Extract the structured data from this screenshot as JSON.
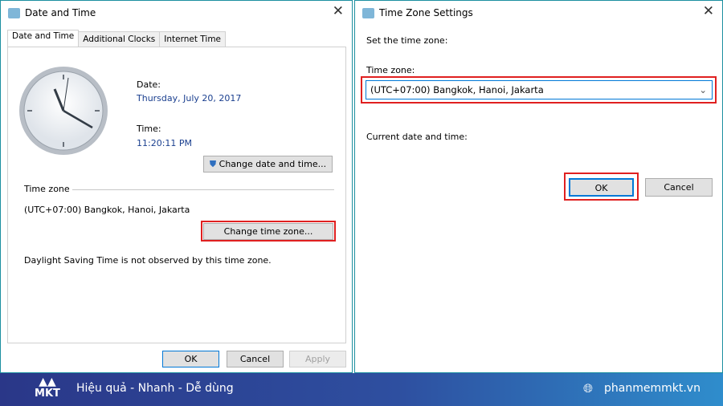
{
  "left_dialog": {
    "title": "Date and Time",
    "tabs": [
      "Date and Time",
      "Additional Clocks",
      "Internet Time"
    ],
    "date_label": "Date:",
    "date_value": "Thursday, July 20, 2017",
    "time_label": "Time:",
    "time_value": "11:20:11 PM",
    "change_date_button": "Change date and time...",
    "timezone_section": "Time zone",
    "timezone_value": "(UTC+07:00) Bangkok, Hanoi, Jakarta",
    "change_timezone_button": "Change time zone...",
    "dst_note": "Daylight Saving Time is not observed by this time zone.",
    "ok": "OK",
    "cancel": "Cancel",
    "apply": "Apply"
  },
  "right_dialog": {
    "title": "Time Zone Settings",
    "instruction": "Set the time zone:",
    "timezone_label": "Time zone:",
    "timezone_selected": "(UTC+07:00) Bangkok, Hanoi, Jakarta",
    "current_label": "Current date and time:",
    "ok": "OK",
    "cancel": "Cancel"
  },
  "banner": {
    "logo": "MKT",
    "slogan": "Hiệu quả - Nhanh - Dễ dùng",
    "website": "phanmemmkt.vn"
  },
  "colors": {
    "highlight": "#e02020",
    "accent": "#0078d7",
    "banner_start": "#2a3788",
    "banner_end": "#2f8dcc"
  }
}
